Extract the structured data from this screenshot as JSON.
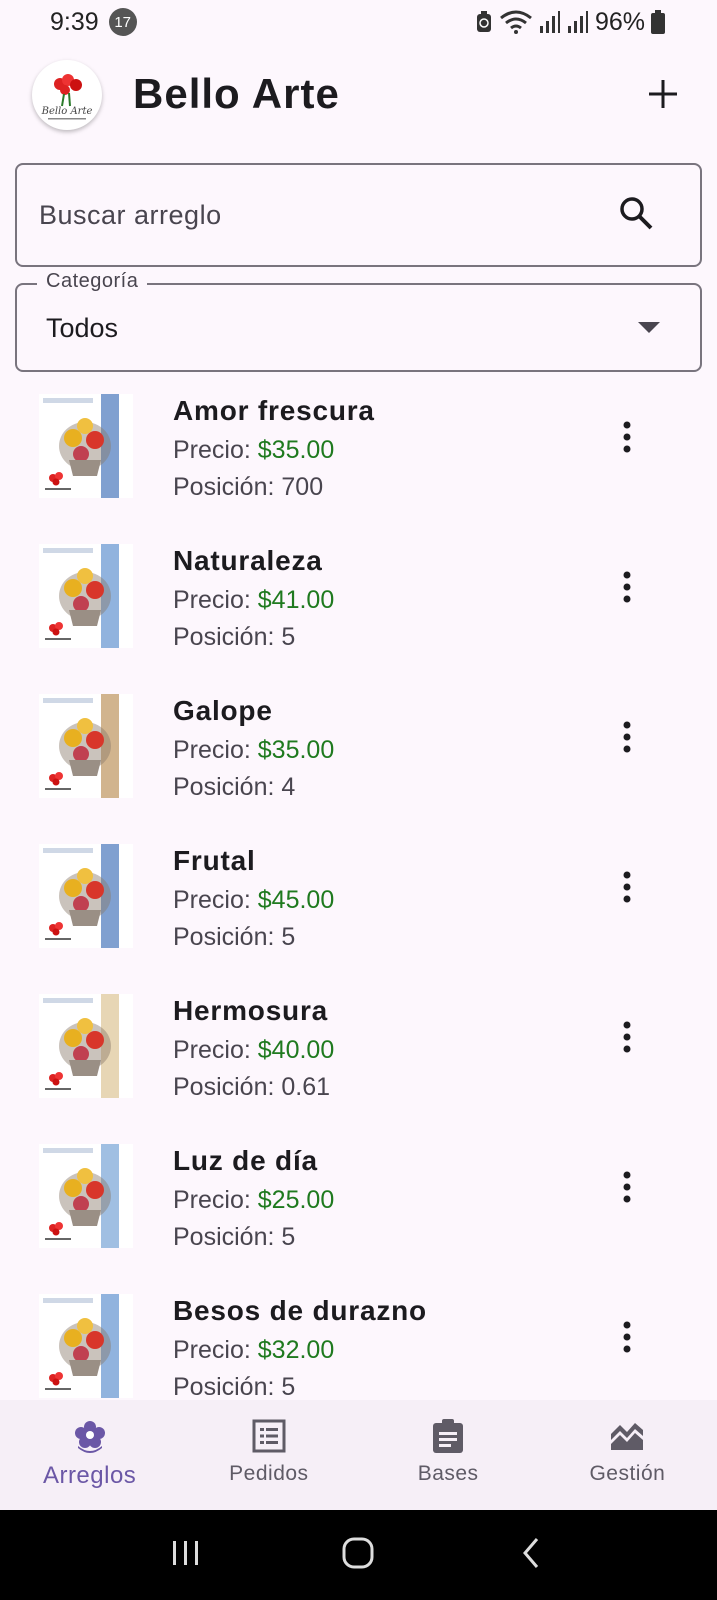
{
  "status_bar": {
    "time": "9:39",
    "notification_count": "17",
    "battery": "96%"
  },
  "app_bar": {
    "title": "Bello Arte",
    "logo_text": "Bello Arte",
    "add_icon": "plus-icon"
  },
  "search": {
    "placeholder": "Buscar arreglo",
    "icon": "search-icon"
  },
  "category": {
    "label": "Categoría",
    "selected": "Todos",
    "icon": "dropdown-arrow-icon"
  },
  "list": {
    "price_label": "Precio: ",
    "position_label": "Posición: ",
    "items": [
      {
        "name": "Amor frescura",
        "price": "$35.00",
        "position": "700",
        "accent": "#6a8fc8"
      },
      {
        "name": "Naturaleza",
        "price": "$41.00",
        "position": "5",
        "accent": "#7ea6d8"
      },
      {
        "name": "Galope",
        "price": "$35.00",
        "position": "4",
        "accent": "#c9a77a"
      },
      {
        "name": "Frutal",
        "price": "$45.00",
        "position": "5",
        "accent": "#6a8fc8"
      },
      {
        "name": "Hermosura",
        "price": "$40.00",
        "position": "0.61",
        "accent": "#e3cfa8"
      },
      {
        "name": "Luz de día",
        "price": "$25.00",
        "position": "5",
        "accent": "#8fb4dd"
      },
      {
        "name": "Besos de durazno",
        "price": "$32.00",
        "position": "5",
        "accent": "#7ea6d8"
      }
    ]
  },
  "bottom_nav": {
    "items": [
      {
        "label": "Arreglos",
        "icon": "flower-icon",
        "active": true
      },
      {
        "label": "Pedidos",
        "icon": "list-icon",
        "active": false
      },
      {
        "label": "Bases",
        "icon": "clipboard-icon",
        "active": false
      },
      {
        "label": "Gestión",
        "icon": "chart-icon",
        "active": false
      }
    ]
  },
  "colors": {
    "accent": "#6b57a6",
    "price": "#1f7a1f",
    "background": "#fdf7fd"
  }
}
